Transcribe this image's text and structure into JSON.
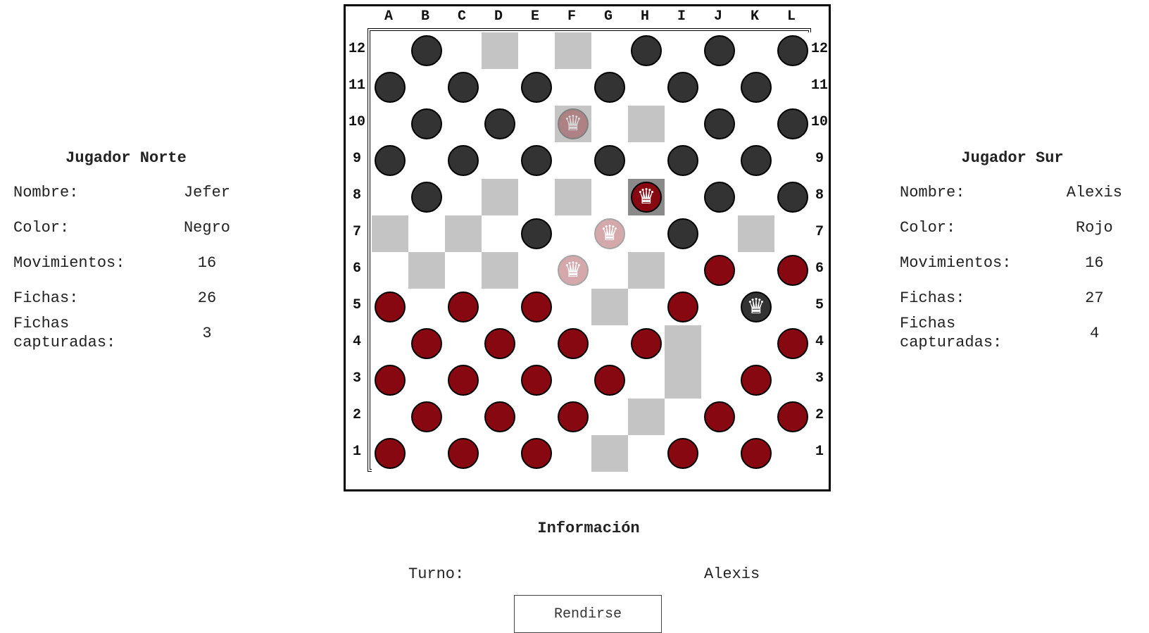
{
  "north": {
    "title": "Jugador Norte",
    "rows": [
      {
        "label": "Nombre:",
        "value": "Jefer"
      },
      {
        "label": "Color:",
        "value": "Negro"
      },
      {
        "label": "Movimientos:",
        "value": "16"
      },
      {
        "label": "Fichas:",
        "value": "26"
      },
      {
        "label": "Fichas capturadas:",
        "value": "3"
      }
    ]
  },
  "south": {
    "title": "Jugador Sur",
    "rows": [
      {
        "label": "Nombre:",
        "value": "Alexis"
      },
      {
        "label": "Color:",
        "value": "Rojo"
      },
      {
        "label": "Movimientos:",
        "value": "16"
      },
      {
        "label": "Fichas:",
        "value": "27"
      },
      {
        "label": "Fichas capturadas:",
        "value": "4"
      }
    ]
  },
  "board": {
    "columns": [
      "A",
      "B",
      "C",
      "D",
      "E",
      "F",
      "G",
      "H",
      "I",
      "J",
      "K",
      "L"
    ],
    "rows": [
      "12",
      "11",
      "10",
      "9",
      "8",
      "7",
      "6",
      "5",
      "4",
      "3",
      "2",
      "1"
    ],
    "colors": {
      "black": "#333333",
      "red": "#880812",
      "dark_square": "#c4c4c4",
      "selected_square": "#8a8a8a"
    },
    "dark_squares": [
      "D12",
      "F12",
      "F10",
      "H10",
      "D8",
      "F8",
      "A7",
      "C7",
      "K7",
      "B6",
      "D6",
      "H6",
      "G5",
      "I4",
      "I3",
      "H2",
      "G1"
    ],
    "selected_squares": [
      "H8"
    ],
    "pieces": [
      {
        "sq": "B12",
        "color": "black"
      },
      {
        "sq": "H12",
        "color": "black"
      },
      {
        "sq": "J12",
        "color": "black"
      },
      {
        "sq": "L12",
        "color": "black"
      },
      {
        "sq": "A11",
        "color": "black"
      },
      {
        "sq": "C11",
        "color": "black"
      },
      {
        "sq": "E11",
        "color": "black"
      },
      {
        "sq": "G11",
        "color": "black"
      },
      {
        "sq": "I11",
        "color": "black"
      },
      {
        "sq": "K11",
        "color": "black"
      },
      {
        "sq": "B10",
        "color": "black"
      },
      {
        "sq": "D10",
        "color": "black"
      },
      {
        "sq": "F10",
        "color": "red",
        "king": true,
        "ghost": true
      },
      {
        "sq": "J10",
        "color": "black"
      },
      {
        "sq": "L10",
        "color": "black"
      },
      {
        "sq": "A9",
        "color": "black"
      },
      {
        "sq": "C9",
        "color": "black"
      },
      {
        "sq": "E9",
        "color": "black"
      },
      {
        "sq": "G9",
        "color": "black"
      },
      {
        "sq": "I9",
        "color": "black"
      },
      {
        "sq": "K9",
        "color": "black"
      },
      {
        "sq": "B8",
        "color": "black"
      },
      {
        "sq": "H8",
        "color": "red",
        "king": true
      },
      {
        "sq": "J8",
        "color": "black"
      },
      {
        "sq": "L8",
        "color": "black"
      },
      {
        "sq": "E7",
        "color": "black"
      },
      {
        "sq": "G7",
        "color": "red",
        "king": true,
        "ghost": true
      },
      {
        "sq": "I7",
        "color": "black"
      },
      {
        "sq": "F6",
        "color": "red",
        "king": true,
        "ghost": true
      },
      {
        "sq": "J6",
        "color": "red"
      },
      {
        "sq": "L6",
        "color": "red"
      },
      {
        "sq": "A5",
        "color": "red"
      },
      {
        "sq": "C5",
        "color": "red"
      },
      {
        "sq": "E5",
        "color": "red"
      },
      {
        "sq": "I5",
        "color": "red"
      },
      {
        "sq": "K5",
        "color": "black",
        "king": true
      },
      {
        "sq": "B4",
        "color": "red"
      },
      {
        "sq": "D4",
        "color": "red"
      },
      {
        "sq": "F4",
        "color": "red"
      },
      {
        "sq": "H4",
        "color": "red"
      },
      {
        "sq": "L4",
        "color": "red"
      },
      {
        "sq": "A3",
        "color": "red"
      },
      {
        "sq": "C3",
        "color": "red"
      },
      {
        "sq": "E3",
        "color": "red"
      },
      {
        "sq": "G3",
        "color": "red"
      },
      {
        "sq": "K3",
        "color": "red"
      },
      {
        "sq": "B2",
        "color": "red"
      },
      {
        "sq": "D2",
        "color": "red"
      },
      {
        "sq": "F2",
        "color": "red"
      },
      {
        "sq": "J2",
        "color": "red"
      },
      {
        "sq": "L2",
        "color": "red"
      },
      {
        "sq": "A1",
        "color": "red"
      },
      {
        "sq": "C1",
        "color": "red"
      },
      {
        "sq": "E1",
        "color": "red"
      },
      {
        "sq": "I1",
        "color": "red"
      },
      {
        "sq": "K1",
        "color": "red"
      }
    ]
  },
  "info": {
    "title": "Información",
    "turn_label": "Turno:",
    "turn_value": "Alexis",
    "surrender_label": "Rendirse"
  }
}
